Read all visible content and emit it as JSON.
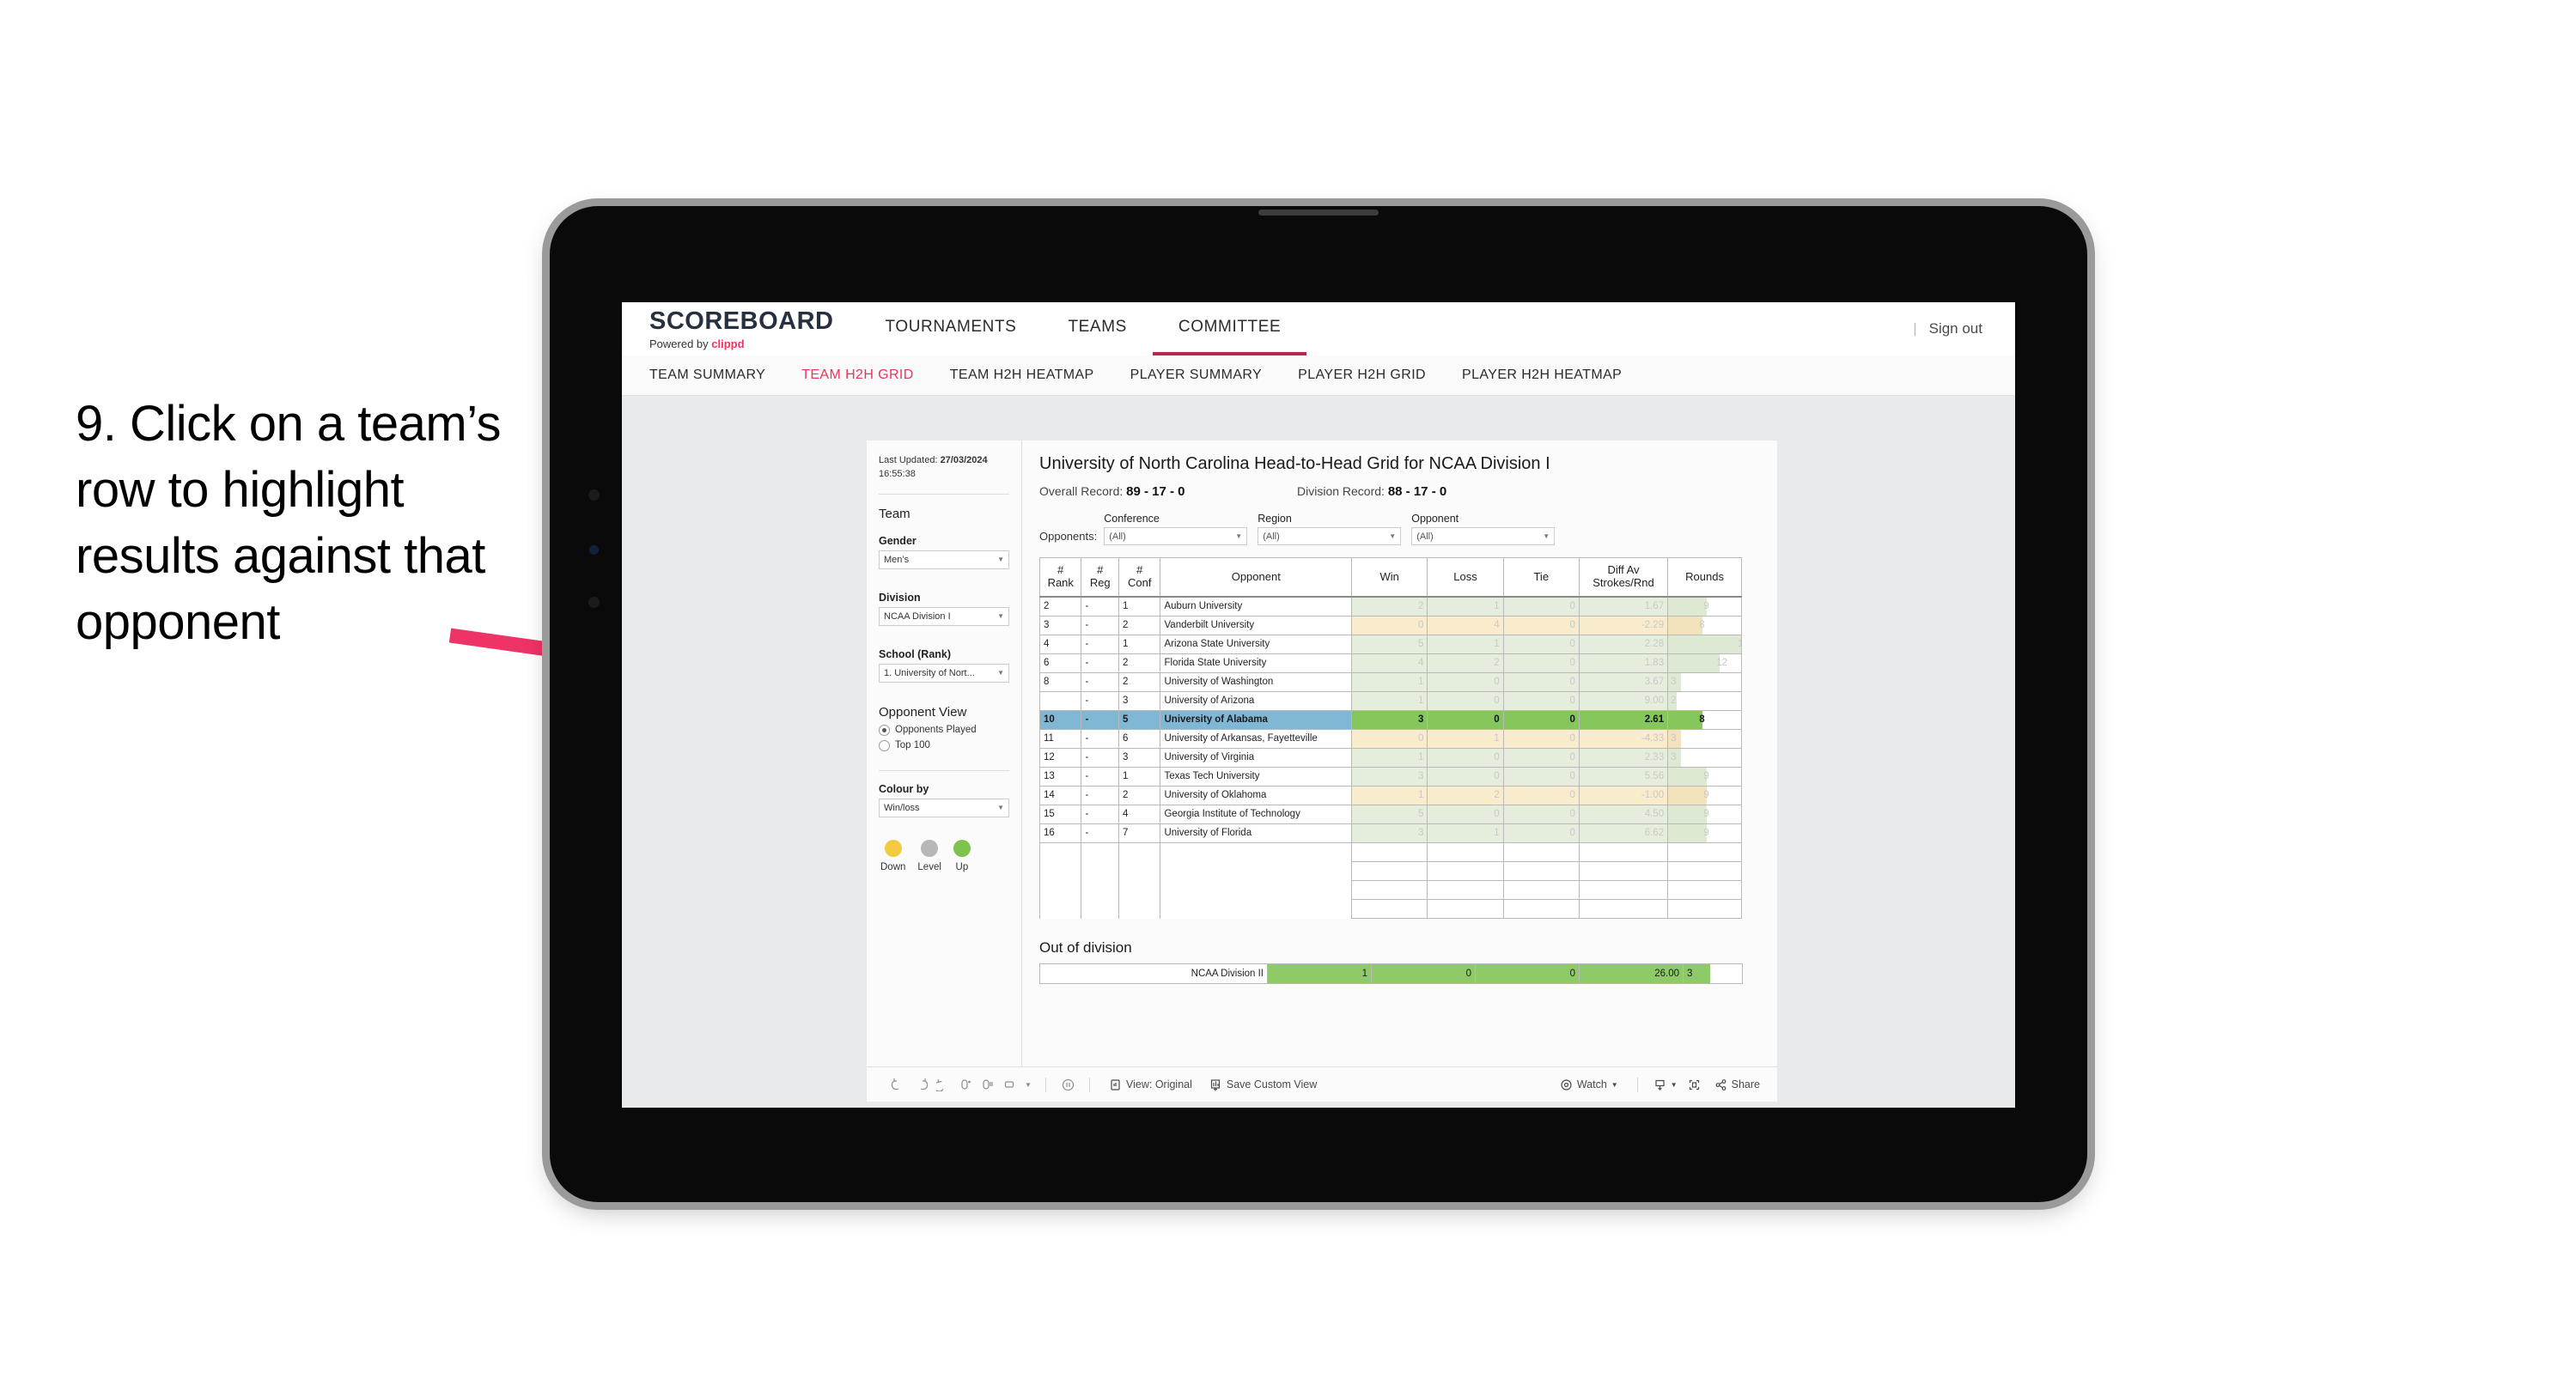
{
  "annotation": {
    "text": "9. Click on a team’s row to highlight results against that opponent",
    "arrow_color": "#ee3366"
  },
  "topnav": {
    "brand_title": "SCOREBOARD",
    "brand_sub_prefix": "Powered by ",
    "brand_sub_name": "clippd",
    "items": [
      {
        "label": "TOURNAMENTS",
        "active": false
      },
      {
        "label": "TEAMS",
        "active": false
      },
      {
        "label": "COMMITTEE",
        "active": true
      }
    ],
    "sign_out": "Sign out",
    "pipe": "|",
    "accent": "#b8264c"
  },
  "subnav": {
    "items": [
      {
        "label": "TEAM SUMMARY",
        "active": false
      },
      {
        "label": "TEAM H2H GRID",
        "active": true
      },
      {
        "label": "TEAM H2H HEATMAP",
        "active": false
      },
      {
        "label": "PLAYER SUMMARY",
        "active": false
      },
      {
        "label": "PLAYER H2H GRID",
        "active": false
      },
      {
        "label": "PLAYER H2H HEATMAP",
        "active": false
      }
    ],
    "active_color": "#e8365d"
  },
  "filters": {
    "last_updated_label": "Last Updated:",
    "last_updated_date": "27/03/2024",
    "last_updated_time": "16:55:38",
    "team_heading": "Team",
    "gender_label": "Gender",
    "gender_value": "Men’s",
    "division_label": "Division",
    "division_value": "NCAA Division I",
    "school_label": "School (Rank)",
    "school_value": "1. University of Nort...",
    "opponent_view_heading": "Opponent View",
    "opponent_view_options": [
      {
        "label": "Opponents Played",
        "selected": true
      },
      {
        "label": "Top 100",
        "selected": false
      }
    ],
    "colour_by_label": "Colour by",
    "colour_by_value": "Win/loss",
    "legend": [
      {
        "label": "Down",
        "color": "#f2cb41"
      },
      {
        "label": "Level",
        "color": "#b7b7b7"
      },
      {
        "label": "Up",
        "color": "#7dc24b"
      }
    ]
  },
  "viz": {
    "title": "University of North Carolina Head-to-Head Grid for NCAA Division I",
    "overall_record_label": "Overall Record:",
    "overall_record_value": "89 - 17 - 0",
    "division_record_label": "Division Record:",
    "division_record_value": "88 - 17 - 0",
    "opponents_label": "Opponents:",
    "dropdowns": [
      {
        "label": "Conference",
        "value": "(All)"
      },
      {
        "label": "Region",
        "value": "(All)"
      },
      {
        "label": "Opponent",
        "value": "(All)"
      }
    ]
  },
  "table": {
    "headers": [
      "# Rank",
      "# Reg",
      "# Conf",
      "Opponent",
      "Win",
      "Loss",
      "Tie",
      "Diff Av Strokes/Rnd",
      "Rounds"
    ],
    "header_lines": [
      [
        "#",
        "Rank"
      ],
      [
        "#",
        "Reg"
      ],
      [
        "#",
        "Conf"
      ],
      [
        "Opponent",
        ""
      ],
      [
        "Win",
        ""
      ],
      [
        "Loss",
        ""
      ],
      [
        "Tie",
        ""
      ],
      [
        "Diff Av",
        "Strokes/Rnd"
      ],
      [
        "Rounds",
        ""
      ]
    ],
    "rows": [
      {
        "rank": "2",
        "reg": "-",
        "conf": "1",
        "opponent": "Auburn University",
        "win": "2",
        "loss": "1",
        "tie": "0",
        "diff": "1.67",
        "rounds": "9",
        "tone": "up",
        "selected": false
      },
      {
        "rank": "3",
        "reg": "-",
        "conf": "2",
        "opponent": "Vanderbilt University",
        "win": "0",
        "loss": "4",
        "tie": "0",
        "diff": "-2.29",
        "rounds": "8",
        "tone": "down",
        "selected": false
      },
      {
        "rank": "4",
        "reg": "-",
        "conf": "1",
        "opponent": "Arizona State University",
        "win": "5",
        "loss": "1",
        "tie": "0",
        "diff": "2.28",
        "rounds": "17",
        "tone": "up",
        "selected": false
      },
      {
        "rank": "6",
        "reg": "-",
        "conf": "2",
        "opponent": "Florida State University",
        "win": "4",
        "loss": "2",
        "tie": "0",
        "diff": "1.83",
        "rounds": "12",
        "tone": "up",
        "selected": false
      },
      {
        "rank": "8",
        "reg": "-",
        "conf": "2",
        "opponent": "University of Washington",
        "win": "1",
        "loss": "0",
        "tie": "0",
        "diff": "3.67",
        "rounds": "3",
        "tone": "up",
        "selected": false
      },
      {
        "rank": "",
        "reg": "-",
        "conf": "3",
        "opponent": "University of Arizona",
        "win": "1",
        "loss": "0",
        "tie": "0",
        "diff": "9.00",
        "rounds": "2",
        "tone": "up",
        "selected": false
      },
      {
        "rank": "10",
        "reg": "-",
        "conf": "5",
        "opponent": "University of Alabama",
        "win": "3",
        "loss": "0",
        "tie": "0",
        "diff": "2.61",
        "rounds": "8",
        "tone": "up",
        "selected": true
      },
      {
        "rank": "11",
        "reg": "-",
        "conf": "6",
        "opponent": "University of Arkansas, Fayetteville",
        "win": "0",
        "loss": "1",
        "tie": "0",
        "diff": "-4.33",
        "rounds": "3",
        "tone": "down",
        "selected": false
      },
      {
        "rank": "12",
        "reg": "-",
        "conf": "3",
        "opponent": "University of Virginia",
        "win": "1",
        "loss": "0",
        "tie": "0",
        "diff": "2.33",
        "rounds": "3",
        "tone": "up",
        "selected": false
      },
      {
        "rank": "13",
        "reg": "-",
        "conf": "1",
        "opponent": "Texas Tech University",
        "win": "3",
        "loss": "0",
        "tie": "0",
        "diff": "5.56",
        "rounds": "9",
        "tone": "up",
        "selected": false
      },
      {
        "rank": "14",
        "reg": "-",
        "conf": "2",
        "opponent": "University of Oklahoma",
        "win": "1",
        "loss": "2",
        "tie": "0",
        "diff": "-1.00",
        "rounds": "9",
        "tone": "down",
        "selected": false
      },
      {
        "rank": "15",
        "reg": "-",
        "conf": "4",
        "opponent": "Georgia Institute of Technology",
        "win": "5",
        "loss": "0",
        "tie": "0",
        "diff": "4.50",
        "rounds": "9",
        "tone": "up",
        "selected": false
      },
      {
        "rank": "16",
        "reg": "-",
        "conf": "7",
        "opponent": "University of Florida",
        "win": "3",
        "loss": "1",
        "tie": "0",
        "diff": "6.62",
        "rounds": "9",
        "tone": "up",
        "selected": false
      }
    ]
  },
  "out_of_division": {
    "heading": "Out of division",
    "row": {
      "name": "NCAA Division II",
      "win": "1",
      "loss": "0",
      "tie": "0",
      "diff": "26.00",
      "rounds": "3"
    }
  },
  "toolbar": {
    "view_label": "View: Original",
    "save_label": "Save Custom View",
    "watch_label": "Watch",
    "share_label": "Share"
  },
  "chart_data": {
    "type": "table",
    "title": "University of North Carolina Head-to-Head Grid for NCAA Division I",
    "columns": [
      "# Rank",
      "# Reg",
      "# Conf",
      "Opponent",
      "Win",
      "Loss",
      "Tie",
      "Diff Av Strokes/Rnd",
      "Rounds"
    ],
    "rows": [
      [
        "2",
        "-",
        "1",
        "Auburn University",
        2,
        1,
        0,
        1.67,
        9
      ],
      [
        "3",
        "-",
        "2",
        "Vanderbilt University",
        0,
        4,
        0,
        -2.29,
        8
      ],
      [
        "4",
        "-",
        "1",
        "Arizona State University",
        5,
        1,
        0,
        2.28,
        17
      ],
      [
        "6",
        "-",
        "2",
        "Florida State University",
        4,
        2,
        0,
        1.83,
        12
      ],
      [
        "8",
        "-",
        "2",
        "University of Washington",
        1,
        0,
        0,
        3.67,
        3
      ],
      [
        "",
        "-",
        "3",
        "University of Arizona",
        1,
        0,
        0,
        9.0,
        2
      ],
      [
        "10",
        "-",
        "5",
        "University of Alabama",
        3,
        0,
        0,
        2.61,
        8
      ],
      [
        "11",
        "-",
        "6",
        "University of Arkansas, Fayetteville",
        0,
        1,
        0,
        -4.33,
        3
      ],
      [
        "12",
        "-",
        "3",
        "University of Virginia",
        1,
        0,
        0,
        2.33,
        3
      ],
      [
        "13",
        "-",
        "1",
        "Texas Tech University",
        3,
        0,
        0,
        5.56,
        9
      ],
      [
        "14",
        "-",
        "2",
        "University of Oklahoma",
        1,
        2,
        0,
        -1.0,
        9
      ],
      [
        "15",
        "-",
        "4",
        "Georgia Institute of Technology",
        5,
        0,
        0,
        4.5,
        9
      ],
      [
        "16",
        "-",
        "7",
        "University of Florida",
        3,
        1,
        0,
        6.62,
        9
      ]
    ],
    "out_of_division": [
      [
        "NCAA Division II",
        1,
        0,
        0,
        26.0,
        3
      ]
    ],
    "selected_row": "University of Alabama",
    "colour_encoding": "Win/loss",
    "colour_scale": {
      "down": "#f2cb41",
      "level": "#b7b7b7",
      "up": "#7dc24b"
    },
    "rounds_max": 17
  }
}
